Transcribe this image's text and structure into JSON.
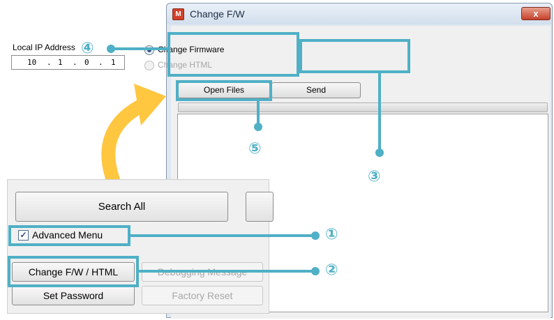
{
  "window": {
    "app_icon": "M",
    "title": "Change F/W",
    "close_label": "x"
  },
  "form": {
    "ip_label": "Local IP Address",
    "ip_octets": [
      "10",
      "1",
      "0",
      "1"
    ],
    "ip_separator": ".",
    "radio_firmware_label": "Change Firmware",
    "radio_html_label": "Change HTML",
    "selected": "Change Firmware",
    "open_files_label": "Open Files",
    "send_label": "Send"
  },
  "main_window": {
    "search_all_label": "Search All",
    "advanced_menu_label": "Advanced Menu",
    "advanced_menu_checked": true,
    "check_glyph": "✓",
    "change_fw_label": "Change F/W / HTML",
    "debugging_label": "Debugging Message",
    "set_password_label": "Set Password",
    "factory_reset_label": "Factory Reset"
  },
  "markers": {
    "m1": "①",
    "m2": "②",
    "m3": "③",
    "m4": "④",
    "m5": "⑤"
  },
  "colors": {
    "annotation": "#4fb0c6",
    "arrow": "#ffc640"
  }
}
